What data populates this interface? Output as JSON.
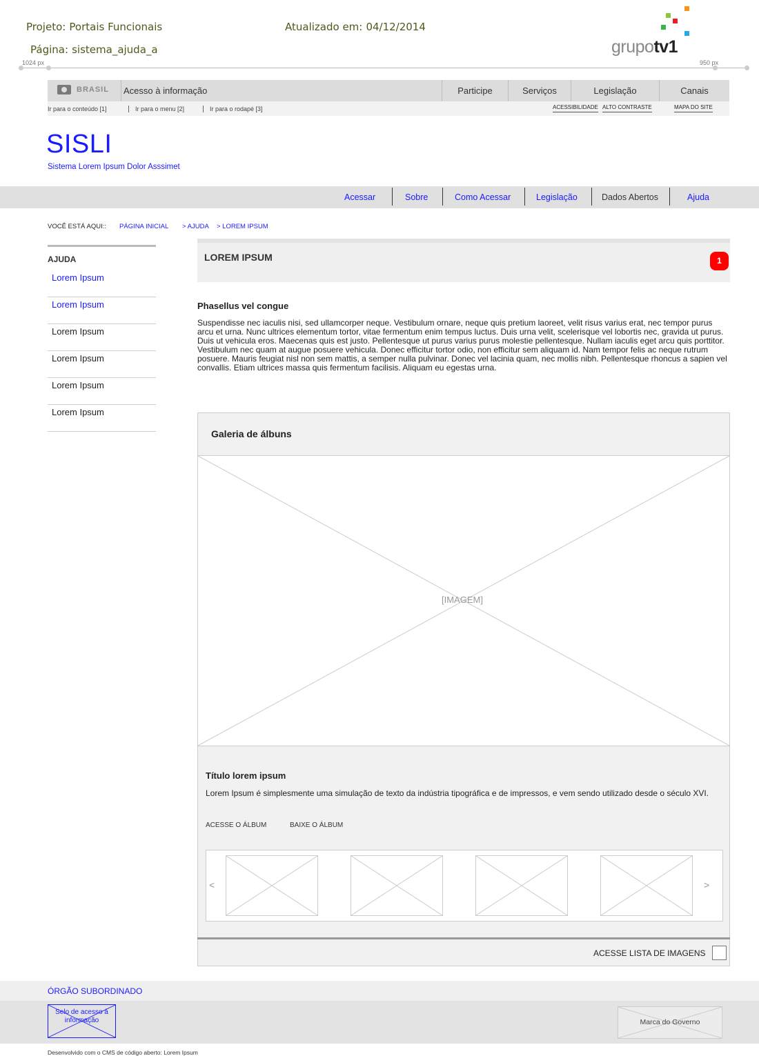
{
  "annotation": {
    "project_label": "Projeto:",
    "project_value": "Portais Funcionais",
    "page_label": "Página:",
    "page_value": "sistema_ajuda_a",
    "updated_label": "Atualizado em:",
    "updated_value": "04/12/2014",
    "ruler_left": "1024 px",
    "ruler_right": "950 px",
    "logo_light": "grupo",
    "logo_bold": "tv1"
  },
  "colors": {
    "link": "#1a1aff",
    "badge": "#ff0000",
    "logo_squares": [
      "#f7941d",
      "#8dc63f",
      "#ed1c24",
      "#27aae1",
      "#39b54a"
    ]
  },
  "gov_bar": {
    "brasil": "BRASIL",
    "access_info": "Acesso à informação",
    "nav": [
      "Participe",
      "Serviços",
      "Legislação",
      "Canais"
    ],
    "skip_links": [
      "Ir para o conteúdo [1]",
      "Ir para o menu [2]",
      "Ir para o rodapé [3]"
    ],
    "right_links": [
      "ACESSIBILIDADE",
      "ALTO CONTRASTE",
      "MAPA DO SITE"
    ]
  },
  "site": {
    "title": "SISLI",
    "subtitle": "Sistema Lorem Ipsum Dolor Asssimet"
  },
  "nav": {
    "items": [
      "Acessar",
      "Sobre",
      "Como Acessar",
      "Legislação",
      "Dados Abertos",
      "Ajuda"
    ]
  },
  "breadcrumb": {
    "label": "VOCÊ ESTÁ AQUI::",
    "items": [
      "PÁGINA INICIAL",
      "> AJUDA",
      "> LOREM IPSUM"
    ]
  },
  "sidebar": {
    "title": "AJUDA",
    "items": [
      "Lorem Ipsum",
      "Lorem Ipsum",
      "Lorem Ipsum",
      "Lorem Ipsum",
      "Lorem Ipsum",
      "Lorem Ipsum"
    ]
  },
  "main": {
    "title": "LOREM IPSUM",
    "badge": "1",
    "heading": "Phasellus vel congue",
    "paragraph": "Suspendisse nec iaculis nisi, sed ullamcorper neque. Vestibulum ornare, neque quis pretium laoreet, velit risus varius erat, nec tempor purus arcu et urna. Nunc ultrices elementum tortor, vitae fermentum enim tempus luctus. Duis urna velit, scelerisque vel lobortis nec, gravida ut purus. Duis ut vehicula eros. Maecenas quis est justo. Pellentesque ut purus varius purus molestie pellentesque. Nullam iaculis eget arcu quis porttitor. Vestibulum nec quam at augue posuere vehicula. Donec efficitur tortor odio, non efficitur sem aliquam id. Nam tempor felis ac neque rutrum posuere. Mauris feugiat nisl non sem mattis, a semper nulla pulvinar. Donec vel lacinia quam, nec mollis nibh. Pellentesque rhoncus a sapien vel convallis. Etiam ultrices massa quis fermentum facilisis. Aliquam eu egestas urna."
  },
  "gallery": {
    "title": "Galeria de álbuns",
    "image_placeholder": "[IMAGEM]",
    "caption_title": "Título lorem ipsum",
    "caption_text": "Lorem Ipsum é simplesmente uma simulação de texto da indústria tipográfica e de impressos, e vem sendo utilizado desde o século XVI.",
    "link_access": "ACESSE O ÁLBUM",
    "link_download": "BAIXE O ÁLBUM",
    "prev": "<",
    "next": ">",
    "list_link": "ACESSE LISTA DE IMAGENS"
  },
  "footer": {
    "orgao": "ÓRGÃO SUBORDINADO",
    "selo": "Selo de acesso à informação",
    "marca": "Marca do Governo",
    "developed": "Desenvolvido com o CMS de código aberto: Lorem Ipsum"
  }
}
